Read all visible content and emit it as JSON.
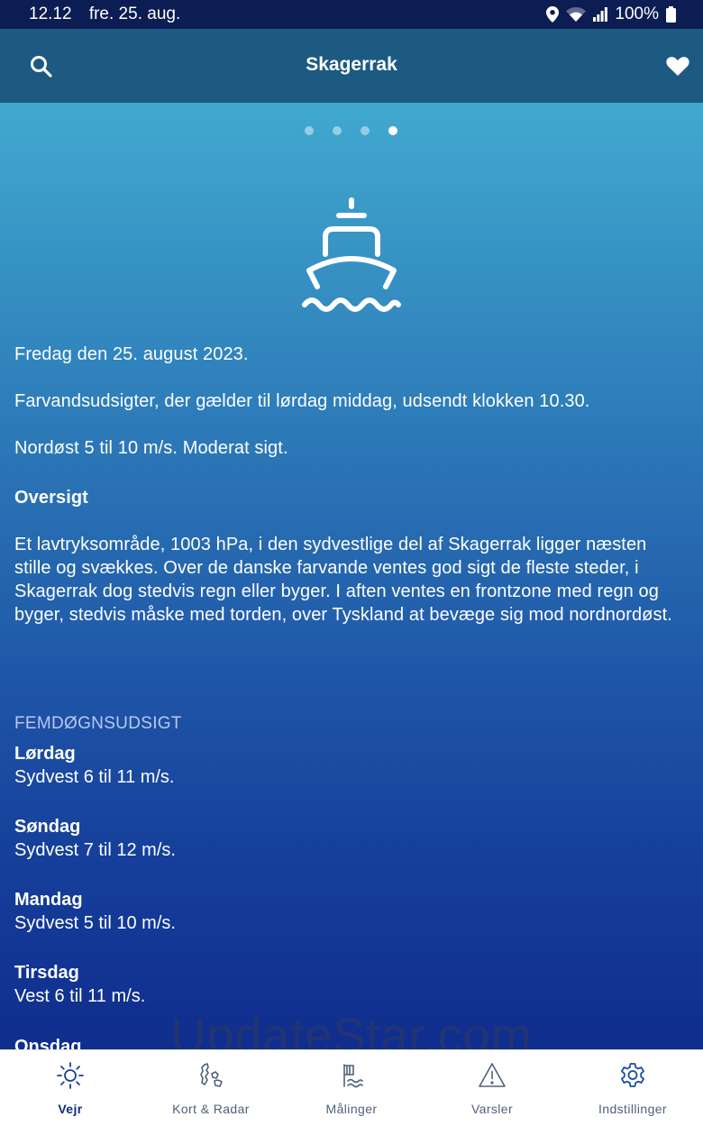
{
  "status_bar": {
    "time": "12.12",
    "date": "fre. 25. aug.",
    "battery": "100%"
  },
  "header": {
    "title": "Skagerrak"
  },
  "pager": {
    "count": 4,
    "active": 4
  },
  "forecast": {
    "date_line": "Fredag den 25. august 2023.",
    "issued_line": "Farvandsudsigter, der gælder til lørdag middag, udsendt klokken 10.30.",
    "wind_line": "Nordøst 5 til 10 m/s. Moderat sigt.",
    "overview_title": "Oversigt",
    "overview_text": "Et lavtryksområde, 1003 hPa, i den sydvestlige del af Skagerrak ligger næsten stille og svækkes. Over de danske farvande ventes god sigt de fleste steder, i Skagerrak dog stedvis regn eller byger. I aften ventes en frontzone med regn og byger, stedvis måske med torden, over Tyskland at bevæge sig mod nordnordøst."
  },
  "five_day": {
    "title": "FEMDØGNSUDSIGT",
    "days": [
      {
        "name": "Lørdag",
        "text": "Sydvest 6 til 11 m/s."
      },
      {
        "name": "Søndag",
        "text": "Sydvest 7 til 12 m/s."
      },
      {
        "name": "Mandag",
        "text": "Sydvest 5 til 10 m/s."
      },
      {
        "name": "Tirsdag",
        "text": "Vest 6 til 11 m/s."
      },
      {
        "name": "Onsdag",
        "text": ""
      }
    ]
  },
  "watermark": "UpdateStar.com",
  "nav": [
    {
      "label": "Vejr",
      "icon": "sun-icon",
      "active": true
    },
    {
      "label": "Kort & Radar",
      "icon": "map-radar-icon",
      "active": false
    },
    {
      "label": "Målinger",
      "icon": "measurement-flag-icon",
      "active": false
    },
    {
      "label": "Varsler",
      "icon": "warning-icon",
      "active": false
    },
    {
      "label": "Indstillinger",
      "icon": "gear-icon",
      "active": false
    }
  ]
}
